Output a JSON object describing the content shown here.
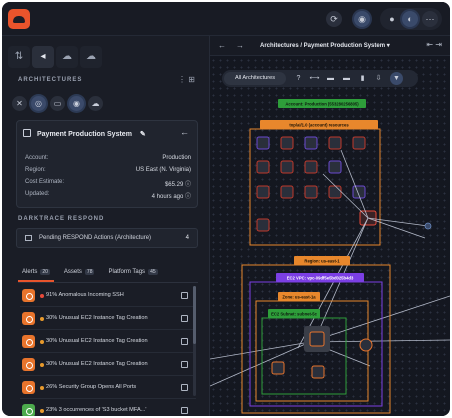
{
  "topbar": {
    "icons": [
      "cloud-logo-icon",
      "refresh-icon",
      "user-circle-icon",
      "theme-toggle-icon",
      "menu-icon"
    ],
    "glyphs": {
      "refresh": "⟳",
      "user": "◉",
      "dot": "●",
      "moon": "◐",
      "menu": "⋯"
    }
  },
  "left_panel": {
    "tab_glyphs": [
      "⇅",
      "◂",
      "☁",
      "☁"
    ],
    "section_title": "ARCHITECTURES",
    "view_glyphs": "⋮ ⊞",
    "filter_glyphs": [
      "✕",
      "◎",
      "▭",
      "◉",
      "☁"
    ],
    "architecture": {
      "name": "Payment Production System",
      "edit_glyph": "✎",
      "back_glyph": "←",
      "fields": [
        {
          "label": "Account:",
          "value": "Production"
        },
        {
          "label": "Region:",
          "value": "US East (N. Virginia)"
        },
        {
          "label": "Cost Estimate:",
          "value": "$65.29 ⓘ"
        },
        {
          "label": "Updated:",
          "value": "4 hours ago ⓘ"
        }
      ]
    },
    "respond_title": "DARKTRACE RESPOND",
    "respond": {
      "label": "Pending RESPOND Actions (Architecture)",
      "count": "4"
    },
    "tabs": [
      {
        "label": "Alerts",
        "badge": "20"
      },
      {
        "label": "Assets",
        "badge": "78"
      },
      {
        "label": "Platform Tags",
        "badge": "45"
      }
    ],
    "alerts": [
      {
        "score": "91%",
        "severity": "high",
        "text": "Anomalous Incoming SSH"
      },
      {
        "score": "30%",
        "severity": "medium",
        "text": "Unusual EC2 Instance Tag Creation"
      },
      {
        "score": "30%",
        "severity": "medium",
        "text": "Unusual EC2 Instance Tag Creation"
      },
      {
        "score": "30%",
        "severity": "medium",
        "text": "Unusual EC2 Instance Tag Creation"
      },
      {
        "score": "26%",
        "severity": "medium",
        "text": "Security Group Opens All Ports"
      },
      {
        "score": "23%",
        "severity": "medium",
        "text": "3 occurrences of 'S3 bucket MFA...'"
      }
    ]
  },
  "right_panel": {
    "back_glyph": "←",
    "forward_glyph": "→",
    "breadcrumb": "Architectures / Payment Production System ▾",
    "nav_glyph": "⇤ ⇥",
    "toolbar": {
      "view_label": "All Architectures",
      "tool_glyphs": [
        "?",
        "⟷",
        "▬",
        "▬",
        "▮",
        "⇩",
        "▼"
      ]
    },
    "diagram": {
      "account_label": "Account: Production (553280256805)",
      "region_group_label": "top/ai/1.0 (account) resources",
      "region_label": "Region: us-east-1",
      "vpc_label": "EC2 VPC: vpc-09df5e5bd025b4d3",
      "az_label": "Zone: us-east-1a",
      "subnet_label": "EC2 Subnet: subnet-5c"
    }
  }
}
